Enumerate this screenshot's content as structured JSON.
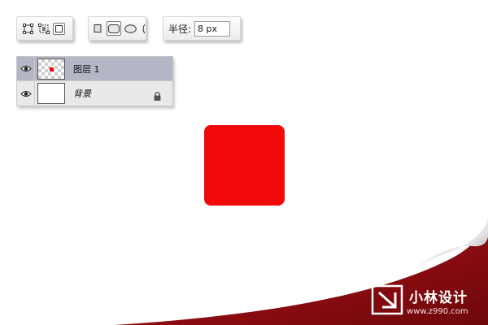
{
  "toolbar_radius": {
    "label": "半径:",
    "value": "8 px"
  },
  "layers": [
    {
      "name": "图层 1",
      "selected": true,
      "thumbnail": "checker-with-red-dot",
      "visible": true
    },
    {
      "name": "背景",
      "selected": false,
      "thumbnail": "white",
      "visible": true,
      "locked": true
    }
  ],
  "icons": {
    "bounding_box": "bounding-box-icon",
    "transform": "transform-controls-icon",
    "rectangle": "rectangle-shape-icon",
    "rounded_rectangle": "rounded-rectangle-icon",
    "ellipse": "ellipse-icon",
    "eye": "eye-icon",
    "lock": "lock-icon"
  },
  "canvas": {
    "shape_color": "#f20a0a"
  },
  "brand": {
    "name": "小林设计",
    "url": "www.z990.com",
    "color": "#8e0f12"
  }
}
